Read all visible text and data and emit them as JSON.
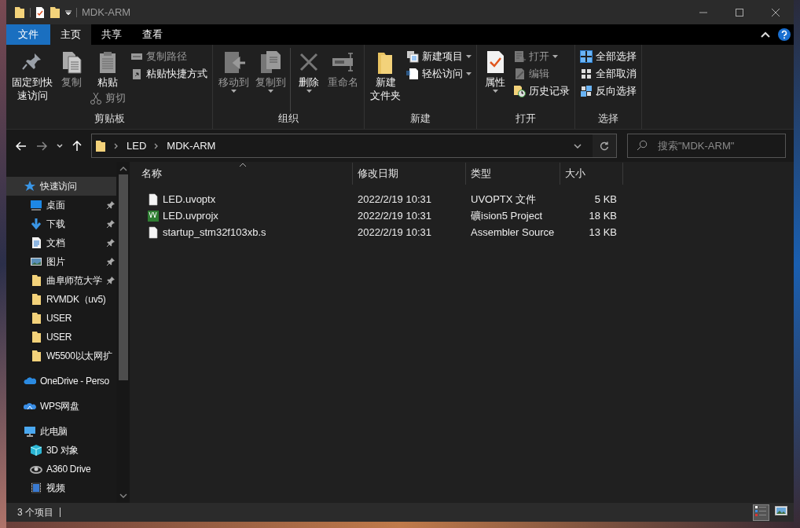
{
  "window": {
    "title": "MDK-ARM"
  },
  "ribbon_tabs": [
    {
      "label": "文件",
      "kind": "file",
      "selected": false
    },
    {
      "label": "主页",
      "kind": "tab",
      "selected": true
    },
    {
      "label": "共享",
      "kind": "tab",
      "selected": false
    },
    {
      "label": "查看",
      "kind": "tab",
      "selected": false
    }
  ],
  "ribbon_groups": [
    {
      "title": "剪贴板",
      "columns": [
        [
          {
            "kind": "large",
            "lines": [
              "固定到快",
              "速访问"
            ],
            "disabled": false
          }
        ],
        [
          {
            "kind": "large",
            "lines": [
              "复制"
            ],
            "disabled": true
          }
        ],
        [
          {
            "kind": "large",
            "lines": [
              "粘贴"
            ],
            "disabled": false
          },
          {
            "kind": "small",
            "label": "剪切",
            "disabled": true
          }
        ],
        [
          {
            "kind": "small",
            "label": "复制路径",
            "disabled": true
          },
          {
            "kind": "small",
            "label": "粘贴快捷方式",
            "disabled": false
          }
        ]
      ]
    },
    {
      "title": "组织",
      "columns": [
        [
          {
            "kind": "large",
            "lines": [
              "移动到"
            ],
            "disabled": true,
            "dropdown": true
          }
        ],
        [
          {
            "kind": "large",
            "lines": [
              "复制到"
            ],
            "disabled": true,
            "dropdown": true
          }
        ],
        [
          {
            "kind": "large",
            "lines": [
              "删除"
            ],
            "disabled": false,
            "dropdown": true
          }
        ],
        [
          {
            "kind": "large",
            "lines": [
              "重命名"
            ],
            "disabled": true
          }
        ]
      ]
    },
    {
      "title": "新建",
      "columns": [
        [
          {
            "kind": "large",
            "lines": [
              "新建",
              "文件夹"
            ],
            "disabled": false
          }
        ],
        [
          {
            "kind": "small",
            "label": "新建项目",
            "disabled": false,
            "dropdown": true
          },
          {
            "kind": "small",
            "label": "轻松访问",
            "disabled": false,
            "dropdown": true
          }
        ]
      ]
    },
    {
      "title": "打开",
      "columns": [
        [
          {
            "kind": "large",
            "lines": [
              "属性"
            ],
            "disabled": false,
            "dropdown": true
          }
        ],
        [
          {
            "kind": "small",
            "label": "打开",
            "disabled": true,
            "dropdown": true
          },
          {
            "kind": "small",
            "label": "编辑",
            "disabled": true
          },
          {
            "kind": "small",
            "label": "历史记录",
            "disabled": false
          }
        ]
      ]
    },
    {
      "title": "选择",
      "columns": [
        [
          {
            "kind": "small",
            "label": "全部选择",
            "disabled": false
          },
          {
            "kind": "small",
            "label": "全部取消",
            "disabled": false
          },
          {
            "kind": "small",
            "label": "反向选择",
            "disabled": false
          }
        ]
      ]
    }
  ],
  "address": {
    "path": [
      "LED",
      "MDK-ARM"
    ]
  },
  "search": {
    "placeholder": "搜索\"MDK-ARM\""
  },
  "navigation": [
    {
      "label": "快速访问",
      "kind": "quick_access",
      "selected": true,
      "children": [
        {
          "label": "桌面",
          "kind": "desktop",
          "pinned": true,
          "selected": false
        },
        {
          "label": "下载",
          "kind": "downloads",
          "pinned": true,
          "selected": false
        },
        {
          "label": "文档",
          "kind": "documents",
          "pinned": true,
          "selected": false
        },
        {
          "label": "图片",
          "kind": "pictures",
          "pinned": true,
          "selected": false
        },
        {
          "label": "曲阜师范大学",
          "kind": "folder",
          "pinned": true,
          "selected": false
        },
        {
          "label": "RVMDK（uv5)",
          "kind": "folder",
          "pinned": false,
          "selected": false
        },
        {
          "label": "USER",
          "kind": "folder",
          "pinned": false,
          "selected": false
        },
        {
          "label": "USER",
          "kind": "folder",
          "pinned": false,
          "selected": false
        },
        {
          "label": "W5500以太网扩",
          "kind": "folder",
          "pinned": false,
          "selected": false
        }
      ]
    },
    {
      "label": "OneDrive - Perso",
      "kind": "cloud",
      "selected": false
    },
    {
      "label": "WPS网盘",
      "kind": "netdisk",
      "selected": false
    },
    {
      "label": "此电脑",
      "kind": "computer",
      "selected": false,
      "children": [
        {
          "label": "3D 对象",
          "kind": "objects",
          "pinned": false,
          "selected": false
        },
        {
          "label": "A360 Drive",
          "kind": "drive",
          "pinned": false,
          "selected": false
        },
        {
          "label": "视频",
          "kind": "videos",
          "pinned": false,
          "selected": false
        }
      ]
    }
  ],
  "file_list": {
    "columns": [
      "名称",
      "修改日期",
      "类型",
      "大小"
    ],
    "rows": [
      {
        "name": "LED.uvoptx",
        "kind": "file",
        "modified": "2022/2/19 10:31",
        "type": "UVOPTX 文件",
        "size": "5 KB"
      },
      {
        "name": "LED.uvprojx",
        "kind": "project",
        "modified": "2022/2/19 10:31",
        "type": "礦ision5 Project",
        "size": "18 KB"
      },
      {
        "name": "startup_stm32f103xb.s",
        "kind": "file",
        "modified": "2022/2/19 10:31",
        "type": "Assembler Source",
        "size": "13 KB"
      }
    ]
  },
  "status_bar": {
    "item_count": "3 个项目",
    "view_buttons": [
      {
        "kind": "details",
        "selected": true
      },
      {
        "kind": "large_icons",
        "selected": false
      }
    ]
  }
}
